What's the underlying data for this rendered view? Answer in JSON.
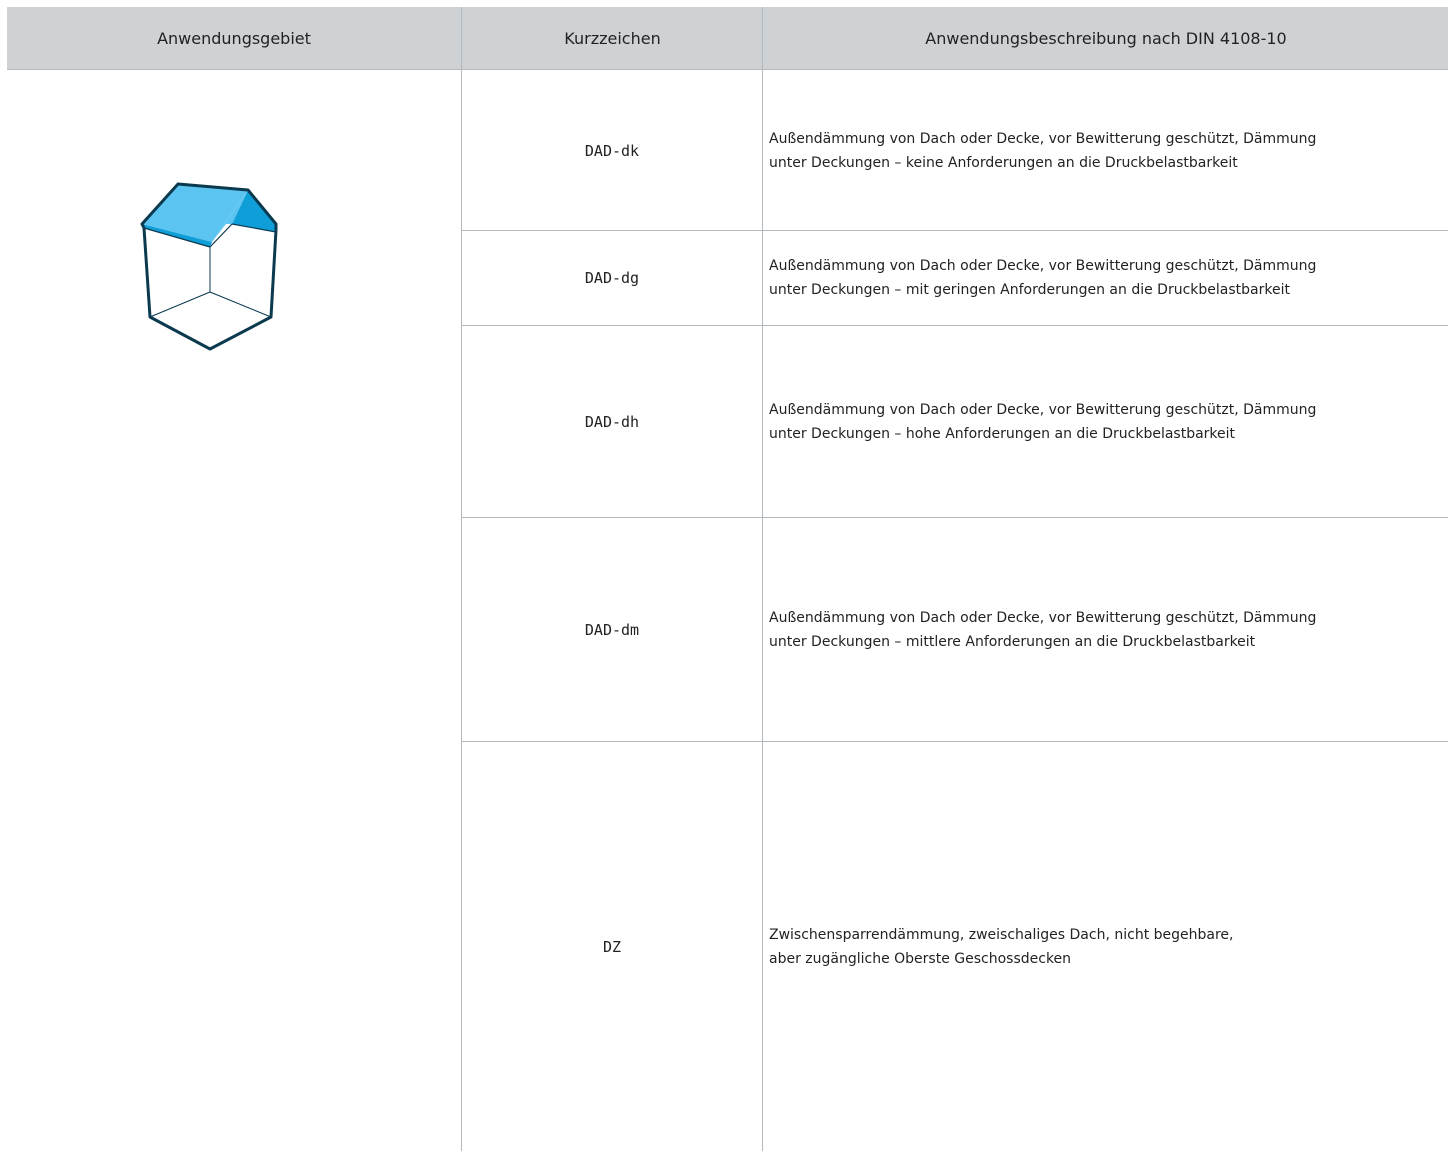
{
  "header": {
    "col_area": "Anwendungsgebiet",
    "col_code": "Kurzzeichen",
    "col_description": "Anwendungsbeschreibung nach DIN 4108-10"
  },
  "icon": "house-roof-insulation-icon",
  "colors": {
    "header_bg": "#ced2d5",
    "roof_blue": "#5bc4f1",
    "roof_dark_blue": "#0f9ed8",
    "outline": "#0b3a4f"
  },
  "rows": [
    {
      "code": "DAD-dk",
      "description": "Außendämmung von Dach oder Decke, vor Bewitterung geschützt, Dämmung\nunter Deckungen – keine Anforderungen an die Druckbelastbarkeit"
    },
    {
      "code": "DAD-dg",
      "description": "Außendämmung von Dach oder Decke, vor Bewitterung geschützt, Dämmung\nunter Deckungen – mit geringen Anforderungen an die Druckbelastbarkeit"
    },
    {
      "code": "DAD-dh",
      "description": "Außendämmung von Dach oder Decke, vor Bewitterung geschützt, Dämmung\nunter Deckungen – hohe Anforderungen an die Druckbelastbarkeit"
    },
    {
      "code": "DAD-dm",
      "description": "Außendämmung von Dach oder Decke, vor Bewitterung geschützt, Dämmung\nunter Deckungen – mittlere Anforderungen an die Druckbelastbarkeit"
    },
    {
      "code": "DZ",
      "description": "Zwischensparrendämmung, zweischaliges Dach, nicht begehbare,\naber zugängliche Oberste Geschossdecken"
    }
  ]
}
